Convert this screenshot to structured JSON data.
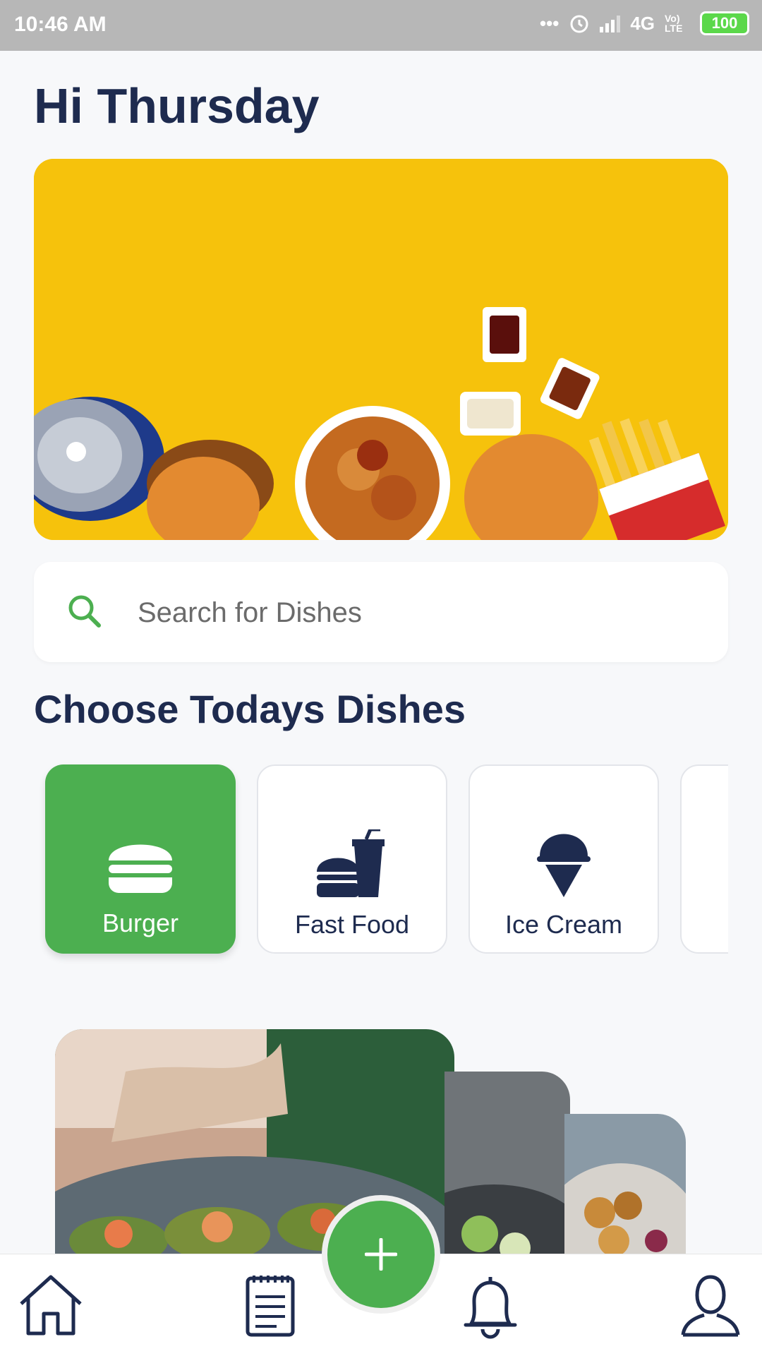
{
  "status_bar": {
    "time": "10:46 AM",
    "network": "4G",
    "volte": "Vo) LTE",
    "battery": "100"
  },
  "greeting": "Hi Thursday",
  "hero": {
    "image": "fast food spread on yellow background"
  },
  "search": {
    "placeholder": "Search for Dishes",
    "value": "",
    "icon": "search-icon"
  },
  "section_title": "Choose Todays Dishes",
  "categories": [
    {
      "label": "Burger",
      "icon": "burger-icon",
      "selected": true
    },
    {
      "label": "Fast Food",
      "icon": "fast-food-icon",
      "selected": false
    },
    {
      "label": "Ice Cream",
      "icon": "ice-cream-icon",
      "selected": false
    },
    {
      "label": "",
      "icon": "",
      "selected": false
    }
  ],
  "dish_cards": [
    {
      "image": "stuffed avocado dish"
    },
    {
      "image": "salad bowl"
    },
    {
      "image": "fried chicken bowl"
    }
  ],
  "bottom_nav": [
    {
      "icon": "home-icon"
    },
    {
      "icon": "notepad-icon"
    },
    {
      "icon": "plus-icon"
    },
    {
      "icon": "bell-icon"
    },
    {
      "icon": "user-icon"
    }
  ],
  "colors": {
    "accent": "#4caf50",
    "heading": "#1e2b4f",
    "hero_bg": "#f6c20c",
    "background": "#f7f8fa"
  }
}
